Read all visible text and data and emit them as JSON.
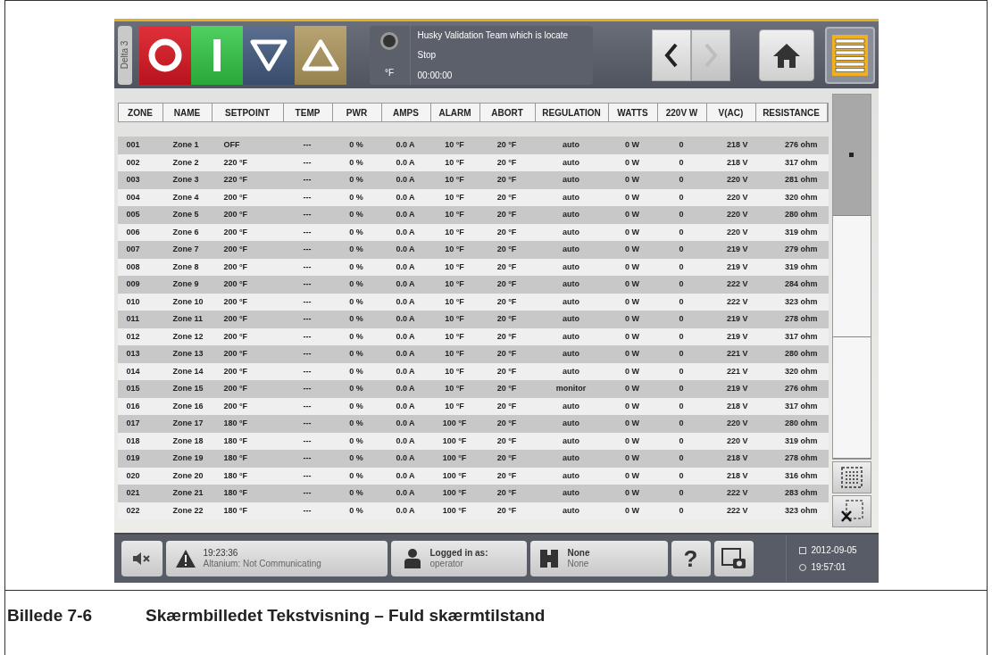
{
  "top_bar": {
    "tab_label": "Delta 3",
    "controls": [
      {
        "kind": "stop"
      },
      {
        "kind": "start"
      },
      {
        "kind": "down"
      },
      {
        "kind": "up"
      }
    ],
    "status": {
      "unit": "°F",
      "message": "Husky Validation Team which is locate",
      "state": "Stop",
      "timer": "00:00:00"
    },
    "nav": [
      {
        "kind": "back",
        "disabled": false
      },
      {
        "kind": "forward",
        "disabled": true
      }
    ],
    "view_button": {
      "selected": true
    }
  },
  "table": {
    "columns": [
      "ZONE",
      "NAME",
      "SETPOINT",
      "TEMP",
      "PWR",
      "AMPS",
      "ALARM",
      "ABORT",
      "REGULATION",
      "WATTS",
      "220V W",
      "V(AC)",
      "RESISTANCE"
    ],
    "rows": [
      [
        "001",
        "Zone 1",
        "OFF",
        "---",
        "0 %",
        "0.0 A",
        "10 °F",
        "20 °F",
        "auto",
        "0 W",
        "0",
        "218 V",
        "276 ohm"
      ],
      [
        "002",
        "Zone 2",
        "220 °F",
        "---",
        "0 %",
        "0.0 A",
        "10 °F",
        "20 °F",
        "auto",
        "0 W",
        "0",
        "218 V",
        "317 ohm"
      ],
      [
        "003",
        "Zone 3",
        "220 °F",
        "---",
        "0 %",
        "0.0 A",
        "10 °F",
        "20 °F",
        "auto",
        "0 W",
        "0",
        "220 V",
        "281 ohm"
      ],
      [
        "004",
        "Zone 4",
        "200 °F",
        "---",
        "0 %",
        "0.0 A",
        "10 °F",
        "20 °F",
        "auto",
        "0 W",
        "0",
        "220 V",
        "320 ohm"
      ],
      [
        "005",
        "Zone 5",
        "200 °F",
        "---",
        "0 %",
        "0.0 A",
        "10 °F",
        "20 °F",
        "auto",
        "0 W",
        "0",
        "220 V",
        "280 ohm"
      ],
      [
        "006",
        "Zone 6",
        "200 °F",
        "---",
        "0 %",
        "0.0 A",
        "10 °F",
        "20 °F",
        "auto",
        "0 W",
        "0",
        "220 V",
        "319 ohm"
      ],
      [
        "007",
        "Zone 7",
        "200 °F",
        "---",
        "0 %",
        "0.0 A",
        "10 °F",
        "20 °F",
        "auto",
        "0 W",
        "0",
        "219 V",
        "279 ohm"
      ],
      [
        "008",
        "Zone 8",
        "200 °F",
        "---",
        "0 %",
        "0.0 A",
        "10 °F",
        "20 °F",
        "auto",
        "0 W",
        "0",
        "219 V",
        "319 ohm"
      ],
      [
        "009",
        "Zone 9",
        "200 °F",
        "---",
        "0 %",
        "0.0 A",
        "10 °F",
        "20 °F",
        "auto",
        "0 W",
        "0",
        "222 V",
        "284 ohm"
      ],
      [
        "010",
        "Zone 10",
        "200 °F",
        "---",
        "0 %",
        "0.0 A",
        "10 °F",
        "20 °F",
        "auto",
        "0 W",
        "0",
        "222 V",
        "323 ohm"
      ],
      [
        "011",
        "Zone 11",
        "200 °F",
        "---",
        "0 %",
        "0.0 A",
        "10 °F",
        "20 °F",
        "auto",
        "0 W",
        "0",
        "219 V",
        "278 ohm"
      ],
      [
        "012",
        "Zone 12",
        "200 °F",
        "---",
        "0 %",
        "0.0 A",
        "10 °F",
        "20 °F",
        "auto",
        "0 W",
        "0",
        "219 V",
        "317 ohm"
      ],
      [
        "013",
        "Zone 13",
        "200 °F",
        "---",
        "0 %",
        "0.0 A",
        "10 °F",
        "20 °F",
        "auto",
        "0 W",
        "0",
        "221 V",
        "280 ohm"
      ],
      [
        "014",
        "Zone 14",
        "200 °F",
        "---",
        "0 %",
        "0.0 A",
        "10 °F",
        "20 °F",
        "auto",
        "0 W",
        "0",
        "221 V",
        "320 ohm"
      ],
      [
        "015",
        "Zone 15",
        "200 °F",
        "---",
        "0 %",
        "0.0 A",
        "10 °F",
        "20 °F",
        "monitor",
        "0 W",
        "0",
        "219 V",
        "276 ohm"
      ],
      [
        "016",
        "Zone 16",
        "200 °F",
        "---",
        "0 %",
        "0.0 A",
        "10 °F",
        "20 °F",
        "auto",
        "0 W",
        "0",
        "218 V",
        "317 ohm"
      ],
      [
        "017",
        "Zone 17",
        "180 °F",
        "---",
        "0 %",
        "0.0 A",
        "100 °F",
        "20 °F",
        "auto",
        "0 W",
        "0",
        "220 V",
        "280 ohm"
      ],
      [
        "018",
        "Zone 18",
        "180 °F",
        "---",
        "0 %",
        "0.0 A",
        "100 °F",
        "20 °F",
        "auto",
        "0 W",
        "0",
        "220 V",
        "319 ohm"
      ],
      [
        "019",
        "Zone 19",
        "180 °F",
        "---",
        "0 %",
        "0.0 A",
        "100 °F",
        "20 °F",
        "auto",
        "0 W",
        "0",
        "218 V",
        "278 ohm"
      ],
      [
        "020",
        "Zone 20",
        "180 °F",
        "---",
        "0 %",
        "0.0 A",
        "100 °F",
        "20 °F",
        "auto",
        "0 W",
        "0",
        "218 V",
        "316 ohm"
      ],
      [
        "021",
        "Zone 21",
        "180 °F",
        "---",
        "0 %",
        "0.0 A",
        "100 °F",
        "20 °F",
        "auto",
        "0 W",
        "0",
        "222 V",
        "283 ohm"
      ],
      [
        "022",
        "Zone 22",
        "180 °F",
        "---",
        "0 %",
        "0.0 A",
        "100 °F",
        "20 °F",
        "auto",
        "0 W",
        "0",
        "222 V",
        "323 ohm"
      ]
    ]
  },
  "pager": [
    {
      "selected": true
    },
    {
      "selected": false
    },
    {
      "selected": false
    }
  ],
  "bottom_bar": {
    "alarm": {
      "time": "19:23:36",
      "message": "Altanium: Not Communicating"
    },
    "login": {
      "label": "Logged in as:",
      "user": "operator"
    },
    "mold": {
      "name": "None",
      "detail": "None"
    },
    "help": "?",
    "date": "2012-09-05",
    "time": "19:57:01"
  },
  "caption": {
    "number": "Billede 7-6",
    "title": "Skærmbilledet Tekstvisning – Fuld skærmtilstand"
  }
}
